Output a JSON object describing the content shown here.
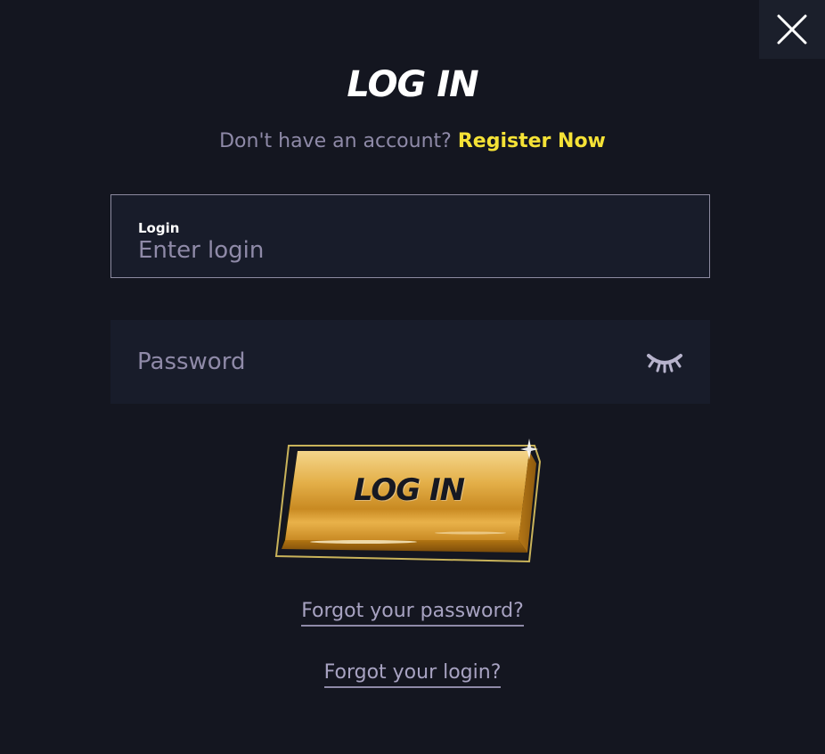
{
  "modal": {
    "title": "LOG IN",
    "register_prompt": "Don't have an account?",
    "register_link": "Register Now"
  },
  "login_field": {
    "label": "Login",
    "placeholder": "Enter login"
  },
  "password_field": {
    "placeholder": "Password"
  },
  "submit": {
    "label": "LOG IN"
  },
  "links": {
    "forgot_password": "Forgot your password?",
    "forgot_login": "Forgot your login?"
  },
  "icons": {
    "close": "close-icon",
    "eye": "eye-closed-icon"
  },
  "colors": {
    "background": "#141620",
    "accent": "#f5e236",
    "button_gold": "#e0a531",
    "muted_text": "#8f8aa8"
  }
}
